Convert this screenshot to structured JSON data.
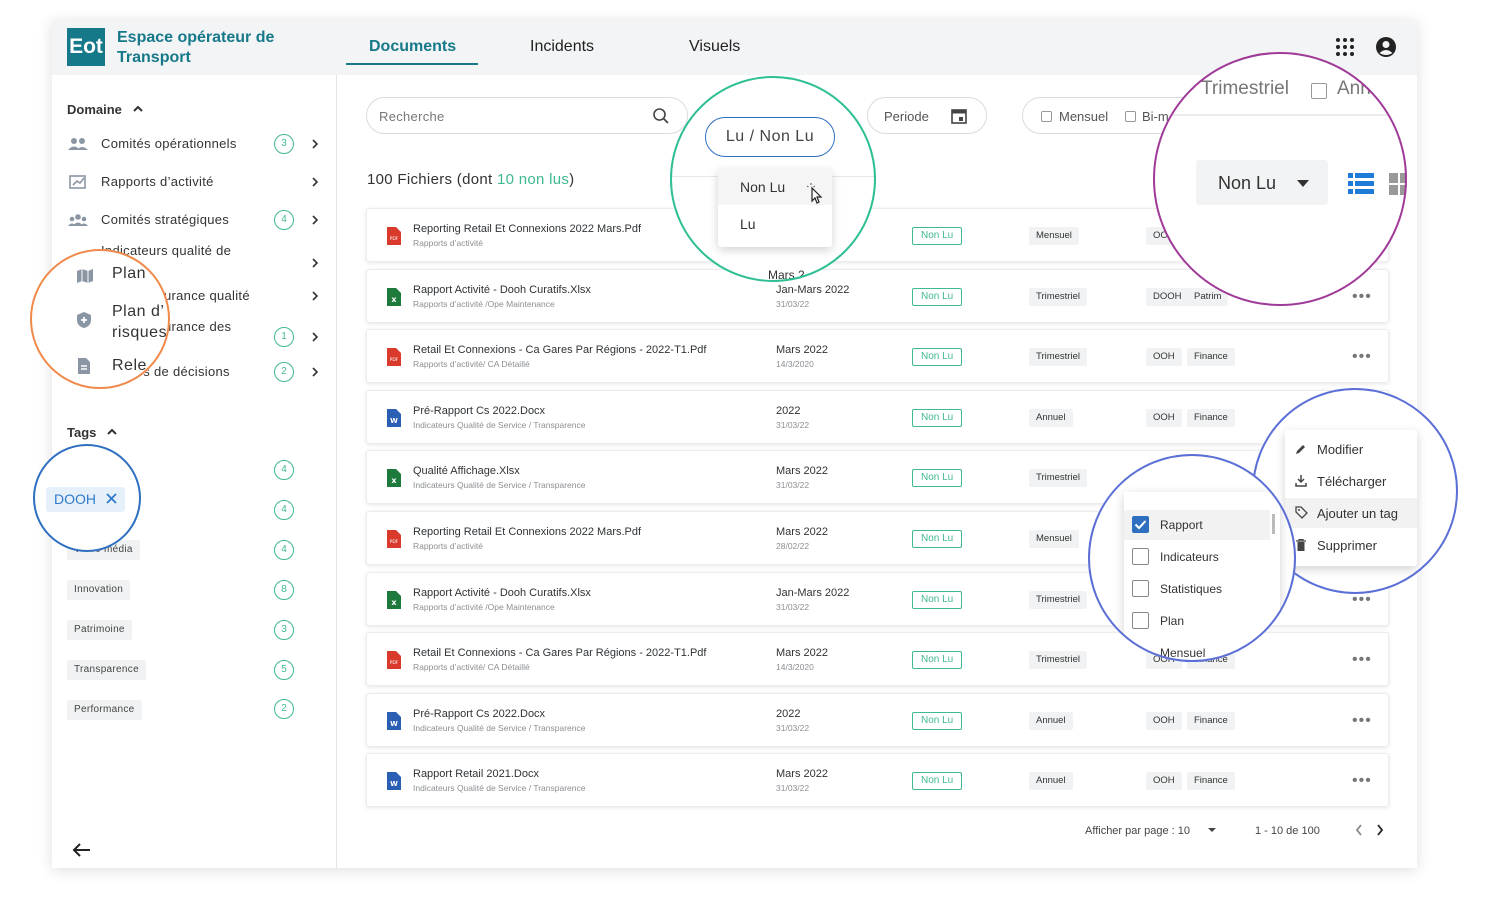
{
  "header": {
    "logo_mark": "Eot",
    "app_title": "Espace opérateur de Transport",
    "tabs": [
      {
        "label": "Documents",
        "active": true
      },
      {
        "label": "Incidents",
        "active": false
      },
      {
        "label": "Visuels",
        "active": false
      }
    ]
  },
  "sidebar": {
    "domain_heading": "Domaine",
    "items": [
      {
        "label": "Comités opérationnels",
        "count": "3",
        "icon": "people-icon"
      },
      {
        "label": "Rapports d’activité",
        "count": "",
        "icon": "report-icon"
      },
      {
        "label": "Comités stratégiques",
        "count": "4",
        "icon": "group-icon"
      },
      {
        "label": "Indicateurs qualité de",
        "count": "",
        "icon": "chart-icon"
      },
      {
        "label": "Plan d’assurance qualité",
        "count": "",
        "icon": "map-icon"
      },
      {
        "label": "Plan d’assurance des",
        "count": "1",
        "icon": "shield-icon"
      },
      {
        "label": "Relevés de décisions",
        "count": "2",
        "icon": "document-icon"
      }
    ],
    "tags_heading": "Tags",
    "tags": [
      {
        "label": "",
        "count": "4"
      },
      {
        "label": "",
        "count": "4"
      },
      {
        "label": "Vidéo média",
        "count": "4"
      },
      {
        "label": "Innovation",
        "count": "8"
      },
      {
        "label": "Patrimoine",
        "count": "3"
      },
      {
        "label": "Transparence",
        "count": "5"
      },
      {
        "label": "Performance",
        "count": "2"
      }
    ]
  },
  "toolbar": {
    "search_placeholder": "Recherche",
    "period_label": "Periode",
    "checkbox_mensuel": "Mensuel",
    "checkbox_bim": "Bi-m"
  },
  "files_summary": {
    "prefix": "100 Fichiers (dont ",
    "highlight": "10 non lus",
    "suffix": ")"
  },
  "rows": [
    {
      "name": "Reporting Retail Et Connexions 2022 Mars.Pdf",
      "path": "Rapports d’activité",
      "period": "",
      "date": "",
      "status": "Non Lu",
      "freq": "Mensuel",
      "tags": [
        "OO"
      ],
      "type": "pdf"
    },
    {
      "name": "Rapport Activité - Dooh Curatifs.Xlsx",
      "path": "Rapports d’activité /Ope Maintenance",
      "period": "Jan-Mars 2022",
      "date": "31/03/22",
      "status": "Non Lu",
      "freq": "Trimestriel",
      "tags": [
        "DOOH",
        "Patrim"
      ],
      "type": "xlsx"
    },
    {
      "name": "Retail Et Connexions - Ca Gares Par Régions - 2022-T1.Pdf",
      "path": "Rapports d’activité/ CA Détaillé",
      "period": "Mars 2022",
      "date": "14/3/2020",
      "status": "Non Lu",
      "freq": "Trimestriel",
      "tags": [
        "OOH",
        "Finance"
      ],
      "type": "pdf"
    },
    {
      "name": "Pré-Rapport Cs 2022.Docx",
      "path": "Indicateurs Qualité de Service / Transparence",
      "period": "2022",
      "date": "31/03/22",
      "status": "Non Lu",
      "freq": "Annuel",
      "tags": [
        "OOH",
        "Finance"
      ],
      "type": "docx"
    },
    {
      "name": "Qualité Affichage.Xlsx",
      "path": "Indicateurs Qualité de Service / Transparence",
      "period": "Mars 2022",
      "date": "31/03/22",
      "status": "Non Lu",
      "freq": "Trimestriel",
      "tags": [],
      "type": "xlsx"
    },
    {
      "name": "Reporting Retail Et Connexions 2022 Mars.Pdf",
      "path": "Rapports d’activité",
      "period": "Mars 2022",
      "date": "28/02/22",
      "status": "Non Lu",
      "freq": "Mensuel",
      "tags": [],
      "type": "pdf"
    },
    {
      "name": "Rapport Activité - Dooh Curatifs.Xlsx",
      "path": "Rapports d’activité /Ope Maintenance",
      "period": "Jan-Mars 2022",
      "date": "31/03/22",
      "status": "Non Lu",
      "freq": "Trimestriel",
      "tags": [],
      "type": "xlsx"
    },
    {
      "name": "Retail Et Connexions - Ca Gares Par Régions - 2022-T1.Pdf",
      "path": "Rapports d’activité/ CA Détaillé",
      "period": "Mars 2022",
      "date": "14/3/2020",
      "status": "Non Lu",
      "freq": "Trimestriel",
      "tags": [
        "OOH",
        "Finance"
      ],
      "type": "pdf"
    },
    {
      "name": "Pré-Rapport Cs 2022.Docx",
      "path": "Indicateurs Qualité de Service / Transparence",
      "period": "2022",
      "date": "31/03/22",
      "status": "Non Lu",
      "freq": "Annuel",
      "tags": [
        "OOH",
        "Finance"
      ],
      "type": "docx"
    },
    {
      "name": "Rapport Retail  2021.Docx",
      "path": "Indicateurs Qualité de Service / Transparence",
      "period": "Mars 2022",
      "date": "31/03/22",
      "status": "Non Lu",
      "freq": "Annuel",
      "tags": [
        "OOH",
        "Finance"
      ],
      "type": "docx"
    }
  ],
  "pagination": {
    "per_page_label": "Afficher par page : 10",
    "range": "1 - 10 de 100"
  },
  "lens_orange": {
    "items": [
      "Plan",
      "Plan d’",
      "risques",
      "Rele"
    ]
  },
  "lens_blue_tag": {
    "chip": "DOOH"
  },
  "lens_green": {
    "filter_label": "Lu / Non Lu",
    "options": [
      "Non Lu",
      "Lu"
    ],
    "partial_text": "Mars 2"
  },
  "lens_purple": {
    "trimestriel": "Trimestriel",
    "annuel_partial": "Ann",
    "dropdown_value": "Non Lu"
  },
  "lens_tags_menu": {
    "options": [
      {
        "label": "Rapport",
        "checked": true
      },
      {
        "label": "Indicateurs",
        "checked": false
      },
      {
        "label": "Statistiques",
        "checked": false
      },
      {
        "label": "Plan",
        "checked": false
      }
    ],
    "cut_label": "Mensuel"
  },
  "lens_actions": {
    "items": [
      "Modifier",
      "Télécharger",
      "Ajouter un tag",
      "Supprimer"
    ]
  },
  "colors": {
    "brand": "#16798a",
    "accent_green": "#3fb98f",
    "orange": "#f08a4b",
    "purple": "#a03a98",
    "blue": "#5b6fd6"
  }
}
